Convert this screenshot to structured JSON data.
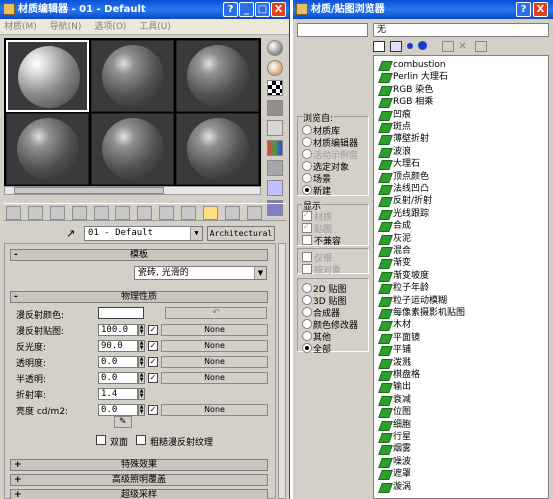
{
  "material_editor": {
    "title": "材质编辑器 - 01 - Default",
    "menu": [
      "材质(M)",
      "导航(N)",
      "选项(O)",
      "工具(U)"
    ],
    "material_name": "01 - Default",
    "material_type_button": "Architectural",
    "rollout_shader": "模板",
    "shader_value": "瓷砖, 光滑的",
    "rollout_physical": "物理性质",
    "diffuse_color_label": "漫反射颜色:",
    "diffuse_map_label": "漫反射贴图:",
    "diffuse_map_value": "100.0",
    "shininess_label": "反光度:",
    "shininess_value": "90.0",
    "transparency_label": "透明度:",
    "transparency_value": "0.0",
    "translucency_label": "半透明:",
    "translucency_value": "0.0",
    "ior_label": "折射率:",
    "ior_value": "1.4",
    "luminance_label": "亮度 cd/m2:",
    "luminance_value": "0.0",
    "map_none": "None",
    "two_sided_label": "双面",
    "raw_diffuse_label": "粗糙漫反射纹理",
    "rollout_special": "特殊效果",
    "rollout_advanced": "高级照明覆盖",
    "rollout_supersampling": "超级采样",
    "title_buttons": [
      "?",
      "_",
      "□",
      "X"
    ]
  },
  "browser": {
    "title": "材质/贴图浏览器",
    "title_buttons": [
      "?",
      "X"
    ],
    "current_value": "无",
    "browse_from_label": "浏览自:",
    "browse_from": [
      {
        "label": "材质库",
        "on": false,
        "disabled": false
      },
      {
        "label": "材质编辑器",
        "on": false,
        "disabled": false
      },
      {
        "label": "活动示例窗",
        "on": false,
        "disabled": true
      },
      {
        "label": "选定对象",
        "on": false,
        "disabled": false
      },
      {
        "label": "场景",
        "on": false,
        "disabled": false
      },
      {
        "label": "新建",
        "on": true,
        "disabled": false
      }
    ],
    "show_label": "显示",
    "show": [
      {
        "label": "材质",
        "disabled": true,
        "checked": true
      },
      {
        "label": "贴图",
        "disabled": true,
        "checked": true
      },
      {
        "label": "不兼容",
        "disabled": false,
        "checked": false
      }
    ],
    "show2": [
      {
        "label": "仅根",
        "disabled": true
      },
      {
        "label": "按对象",
        "disabled": true
      }
    ],
    "map_filters": [
      {
        "label": "2D 贴图",
        "on": false
      },
      {
        "label": "3D 贴图",
        "on": false
      },
      {
        "label": "合成器",
        "on": false
      },
      {
        "label": "颜色修改器",
        "on": false
      },
      {
        "label": "其他",
        "on": false
      },
      {
        "label": "全部",
        "on": true
      }
    ],
    "items": [
      "combustion",
      "Perlin 大理石",
      "RGB 染色",
      "RGB 相乘",
      "凹痕",
      "斑点",
      "薄壁折射",
      "波浪",
      "大理石",
      "顶点颜色",
      "法线凹凸",
      "反射/折射",
      "光线跟踪",
      "合成",
      "灰泥",
      "混合",
      "渐变",
      "渐变坡度",
      "粒子年龄",
      "粒子运动模糊",
      "每像素摄影机贴图",
      "木材",
      "平面镜",
      "平铺",
      "泼溅",
      "棋盘格",
      "输出",
      "衰减",
      "位图",
      "细胞",
      "行星",
      "烟雾",
      "噪波",
      "遮罩",
      "漩涡"
    ]
  }
}
